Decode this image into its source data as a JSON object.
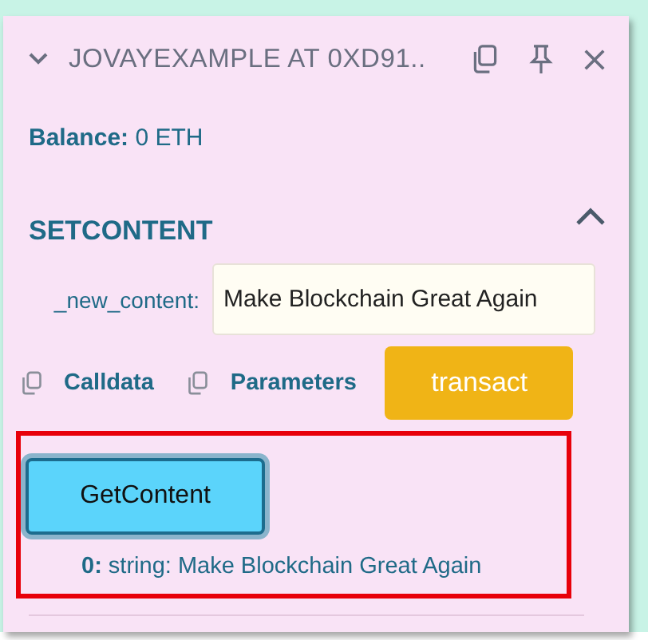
{
  "panel": {
    "title": "JOVAYEXAMPLE AT 0XD91..",
    "expanded": true
  },
  "balance": {
    "label": "Balance:",
    "value": "0 ETH"
  },
  "function": {
    "title": "SETCONTENT",
    "expanded": true,
    "inputs": [
      {
        "label": "_new_content:",
        "value": "Make Blockchain Great Again"
      }
    ],
    "copy_links": [
      "Calldata",
      "Parameters"
    ],
    "action": "transact"
  },
  "call": {
    "highlighted": true,
    "button": "GetContent",
    "result_index": "0:",
    "result": "string: Make Blockchain Great Again"
  }
}
